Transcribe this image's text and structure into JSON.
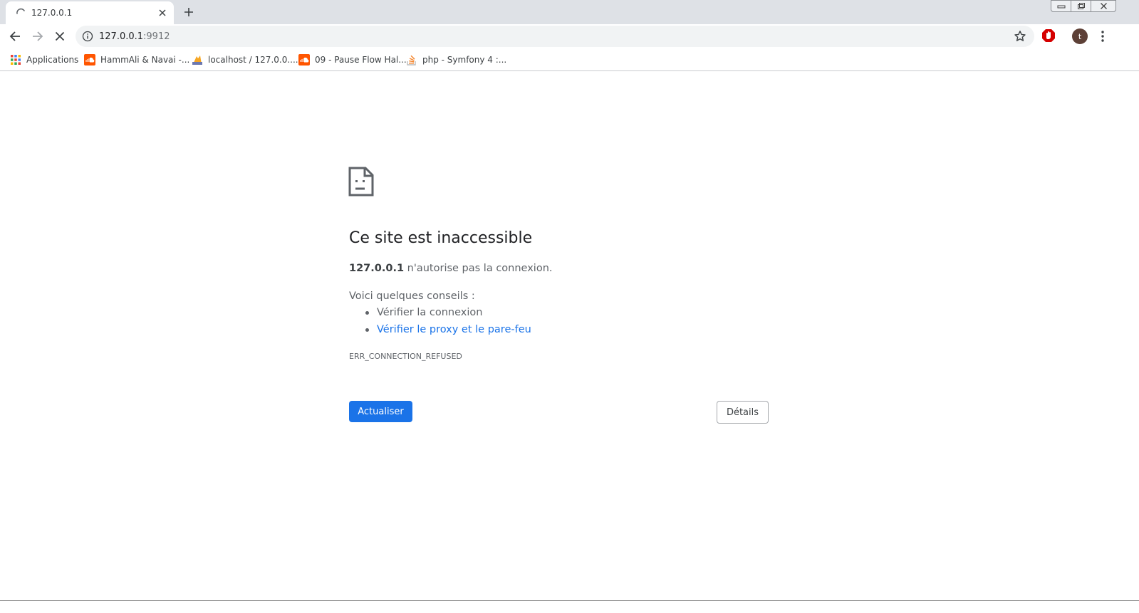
{
  "tab": {
    "title": "127.0.0.1"
  },
  "toolbar": {
    "url_host": "127.0.0.1",
    "url_port": ":9912",
    "profile_initial": "t"
  },
  "bookmarks": [
    {
      "label": "Applications",
      "icon": "apps-grid-icon"
    },
    {
      "label": "HammAli & Navai -...",
      "icon": "soundcloud-icon"
    },
    {
      "label": "localhost / 127.0.0....",
      "icon": "phpmyadmin-icon"
    },
    {
      "label": "09 - Pause Flow Hal...",
      "icon": "soundcloud-icon"
    },
    {
      "label": "php - Symfony 4 :...",
      "icon": "stackoverflow-icon"
    }
  ],
  "error": {
    "title": "Ce site est inaccessible",
    "host": "127.0.0.1",
    "message": " n'autorise pas la connexion.",
    "tips_heading": "Voici quelques conseils :",
    "tips": [
      {
        "text": "Vérifier la connexion",
        "link": false
      },
      {
        "text": "Vérifier le proxy et le pare-feu",
        "link": true
      }
    ],
    "code": "ERR_CONNECTION_REFUSED",
    "reload_label": "Actualiser",
    "details_label": "Détails"
  },
  "colors": {
    "accent": "#1a73e8",
    "tabstrip": "#dee1e6",
    "omnibox": "#f1f3f4"
  }
}
